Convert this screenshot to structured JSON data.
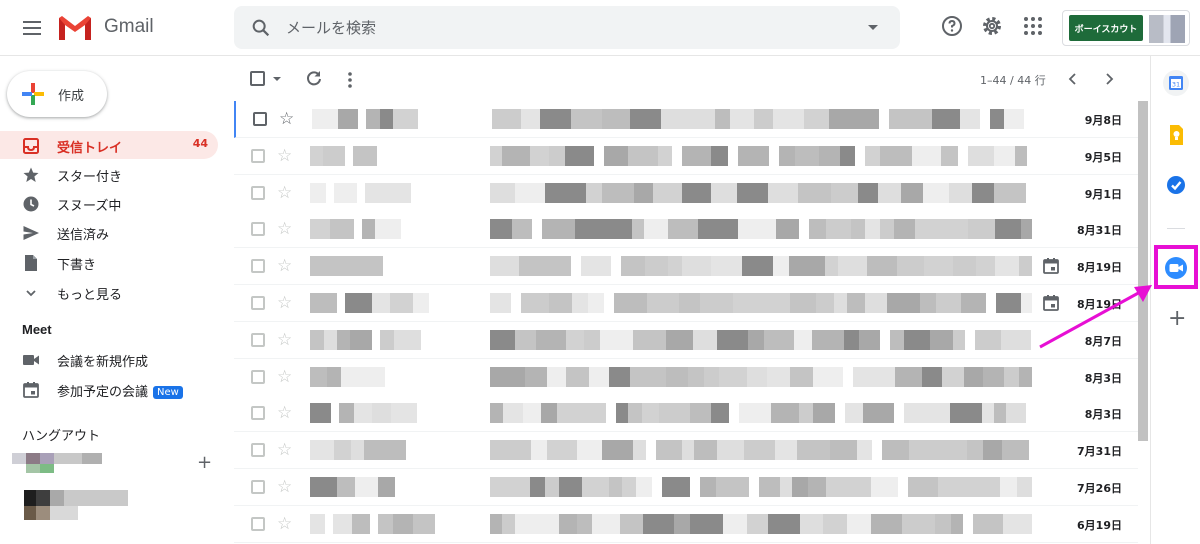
{
  "app": {
    "logo_text": "Gmail"
  },
  "search": {
    "placeholder": "メールを検索"
  },
  "account": {
    "org_logo_text": "ボーイスカウト"
  },
  "compose": {
    "label": "作成"
  },
  "nav": {
    "items": [
      {
        "label": "受信トレイ",
        "count": "44",
        "icon": "inbox-icon",
        "active": true
      },
      {
        "label": "スター付き",
        "icon": "star-icon"
      },
      {
        "label": "スヌーズ中",
        "icon": "clock-icon"
      },
      {
        "label": "送信済み",
        "icon": "send-icon"
      },
      {
        "label": "下書き",
        "icon": "draft-icon"
      },
      {
        "label": "もっと見る",
        "icon": "chevron-down-icon"
      }
    ]
  },
  "meet": {
    "title": "Meet",
    "items": [
      {
        "label": "会議を新規作成",
        "icon": "video-camera-icon"
      },
      {
        "label": "参加予定の会議",
        "badge": "New",
        "icon": "calendar-icon"
      }
    ]
  },
  "hangouts": {
    "title": "ハングアウト"
  },
  "toolbar": {
    "pager": "1–44 / 44 行"
  },
  "emails": [
    {
      "date": "9月8日"
    },
    {
      "date": "9月5日"
    },
    {
      "date": "9月1日"
    },
    {
      "date": "8月31日"
    },
    {
      "date": "8月19日",
      "has_calendar": true
    },
    {
      "date": "8月19日",
      "has_calendar": true
    },
    {
      "date": "8月7日"
    },
    {
      "date": "8月3日"
    },
    {
      "date": "8月3日"
    },
    {
      "date": "7月31日"
    },
    {
      "date": "7月26日"
    },
    {
      "date": "6月19日"
    }
  ],
  "colors": {
    "accent_red": "#d93025",
    "active_bg": "#fce8e6",
    "new_badge": "#1a73e8",
    "highlight": "#e70fd4"
  },
  "right_panel": {
    "addons": [
      "google-calendar-icon",
      "google-keep-icon",
      "google-tasks-icon",
      "zoom-icon"
    ]
  }
}
